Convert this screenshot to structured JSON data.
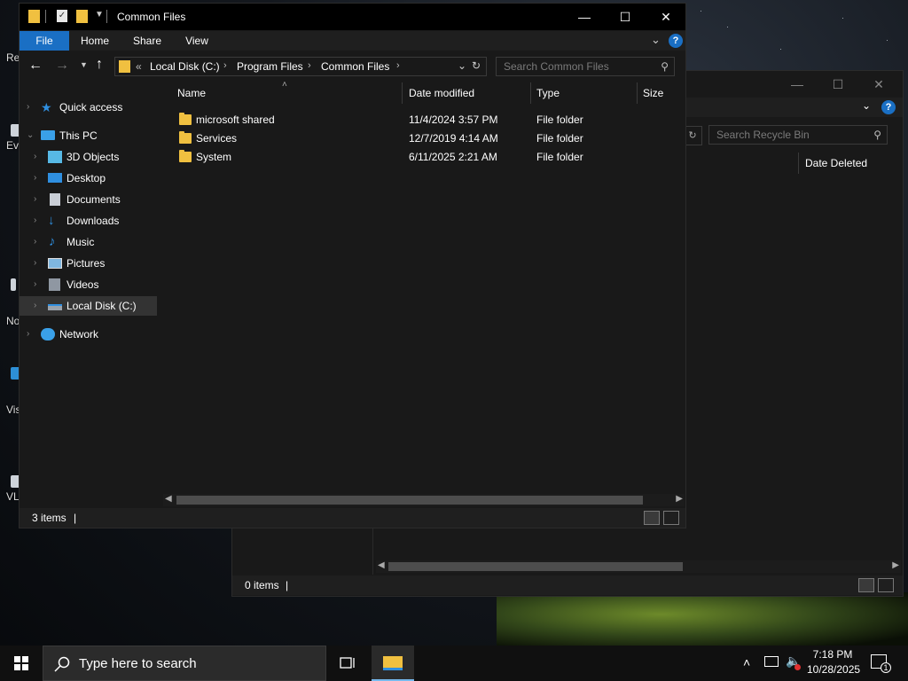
{
  "desktop": {
    "icons": [
      {
        "label": "Re"
      },
      {
        "label": "Ev"
      },
      {
        "label": "No"
      },
      {
        "label": "Visi"
      },
      {
        "label": "VL"
      }
    ]
  },
  "back_window": {
    "search_placeholder": "Search Recycle Bin",
    "column_date_deleted": "Date Deleted",
    "status_items": "0 items"
  },
  "main_window": {
    "title": "Common Files",
    "ribbon": {
      "file": "File",
      "home": "Home",
      "share": "Share",
      "view": "View"
    },
    "address": {
      "overflow": "«",
      "crumbs": [
        "Local Disk (C:)",
        "Program Files",
        "Common Files"
      ]
    },
    "search_placeholder": "Search Common Files",
    "nav": {
      "quick_access": "Quick access",
      "this_pc": "This PC",
      "objects3d": "3D Objects",
      "desktop": "Desktop",
      "documents": "Documents",
      "downloads": "Downloads",
      "music": "Music",
      "pictures": "Pictures",
      "videos": "Videos",
      "local_disk": "Local Disk (C:)",
      "network": "Network"
    },
    "columns": {
      "name": "Name",
      "date_modified": "Date modified",
      "type": "Type",
      "size": "Size"
    },
    "files": [
      {
        "name": "microsoft shared",
        "date": "11/4/2024 3:57 PM",
        "type": "File folder",
        "size": ""
      },
      {
        "name": "Services",
        "date": "12/7/2019 4:14 AM",
        "type": "File folder",
        "size": ""
      },
      {
        "name": "System",
        "date": "6/11/2025 2:21 AM",
        "type": "File folder",
        "size": ""
      }
    ],
    "status_items": "3 items"
  },
  "taskbar": {
    "search_placeholder": "Type here to search",
    "time": "7:18 PM",
    "date": "10/28/2025",
    "notification_count": "1"
  },
  "colors": {
    "accent": "#1a6fc4",
    "folder": "#f0c040",
    "window_bg": "#191919",
    "titlebar_bg": "#000000"
  }
}
